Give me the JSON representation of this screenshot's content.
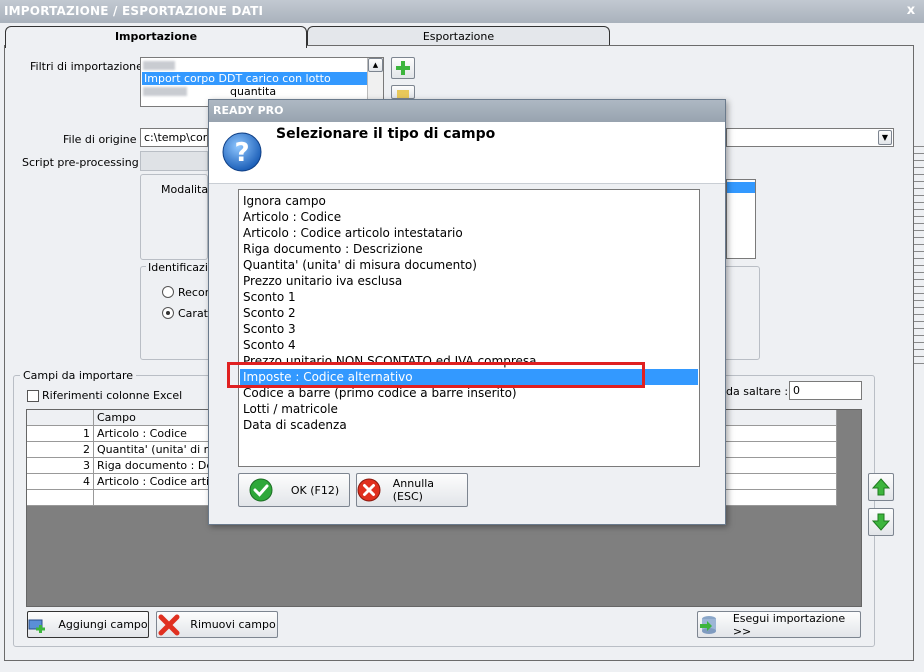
{
  "window": {
    "title": "IMPORTAZIONE / ESPORTAZIONE DATI",
    "close_glyph": "x"
  },
  "tabs": [
    "Importazione",
    "Esportazione"
  ],
  "filters": {
    "label": "Filtri di importazione :",
    "items": [
      "",
      "Import corpo DDT carico con lotto",
      "quantita"
    ]
  },
  "file_origin": {
    "label": "File di origine :",
    "value": "c:\\temp\\corpo"
  },
  "script": {
    "label": "Script pre-processing :"
  },
  "mode": {
    "label": "Modalita' di"
  },
  "identification": {
    "label": "Identificazion",
    "options": [
      "Recor",
      "Caratte"
    ]
  },
  "fields": {
    "group_label": "Campi da importare",
    "excel_checkbox": "Riferimenti colonne Excel",
    "skip_label": "da saltare :",
    "skip_value": "0",
    "header": "Campo",
    "rows": [
      {
        "num": "1",
        "field": "Articolo : Codice"
      },
      {
        "num": "2",
        "field": "Quantita' (unita' di misu"
      },
      {
        "num": "3",
        "field": "Riga documento : Descr"
      },
      {
        "num": "4",
        "field": "Articolo : Codice articol"
      }
    ]
  },
  "buttons": {
    "add": "Aggiungi campo",
    "remove": "Rimuovi campo",
    "run": "Esegui importazione >>"
  },
  "dialog": {
    "title": "READY PRO",
    "heading": "Selezionare il tipo di campo",
    "icon": "question-icon",
    "options": [
      "Ignora campo",
      "Articolo : Codice",
      "Articolo : Codice articolo intestatario",
      "Riga documento : Descrizione",
      "Quantita' (unita' di misura documento)",
      "Prezzo unitario iva esclusa",
      "Sconto 1",
      "Sconto 2",
      "Sconto 3",
      "Sconto 4",
      "Prezzo unitario NON SCONTATO ed IVA compresa",
      "Imposte : Codice alternativo",
      "Codice a barre (primo codice a barre inserito)",
      "Lotti / matricole",
      "Data di scadenza"
    ],
    "selected_index": 11,
    "ok": "OK (F12)",
    "cancel": "Annulla (ESC)"
  },
  "colors": {
    "selection": "#3399ff",
    "highlight_box": "#e02020",
    "accent_green": "#3db53d"
  }
}
